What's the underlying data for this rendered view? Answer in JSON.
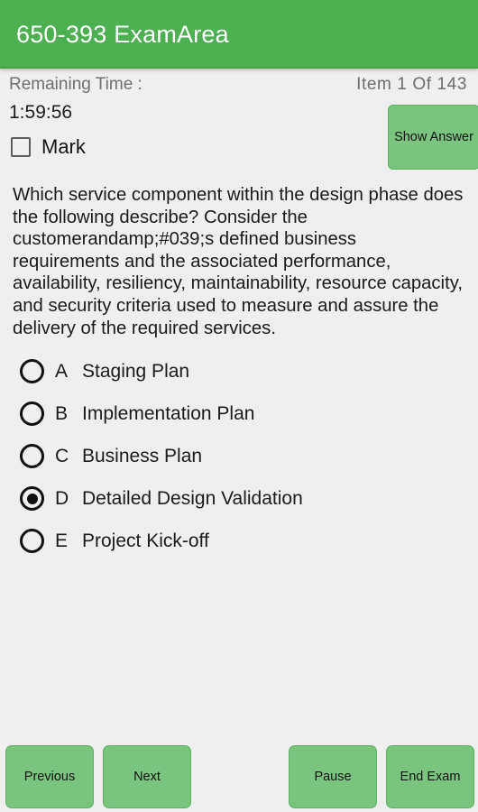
{
  "appbar": {
    "title": "650-393 ExamArea"
  },
  "status": {
    "remaining_time_label": "Remaining Time :",
    "item_counter": "Item 1 Of 143",
    "timer_value": "1:59:56",
    "mark_label": "Mark",
    "mark_checked": false,
    "show_answer_label": "Show Answer"
  },
  "question": {
    "text": "Which service component within the design phase does the following describe? Consider the customerandamp;#039;s defined business requirements and the associated performance, availability, resiliency, maintainability, resource capacity, and security criteria used to measure and assure the delivery of the required services."
  },
  "options": [
    {
      "letter": "A",
      "text": "Staging Plan",
      "selected": false
    },
    {
      "letter": "B",
      "text": "Implementation Plan",
      "selected": false
    },
    {
      "letter": "C",
      "text": "Business Plan",
      "selected": false
    },
    {
      "letter": "D",
      "text": "Detailed Design Validation",
      "selected": true
    },
    {
      "letter": "E",
      "text": "Project Kick-off",
      "selected": false
    }
  ],
  "bottom_bar": {
    "previous_label": "Previous",
    "next_label": "Next",
    "pause_label": "Pause",
    "end_exam_label": "End Exam"
  },
  "colors": {
    "appbar_green": "#4caf50",
    "button_green": "#7ac57e",
    "button_border_green": "#5faf66",
    "page_background": "#efefef",
    "text_primary": "#1b1b1b",
    "text_muted": "#707070"
  }
}
